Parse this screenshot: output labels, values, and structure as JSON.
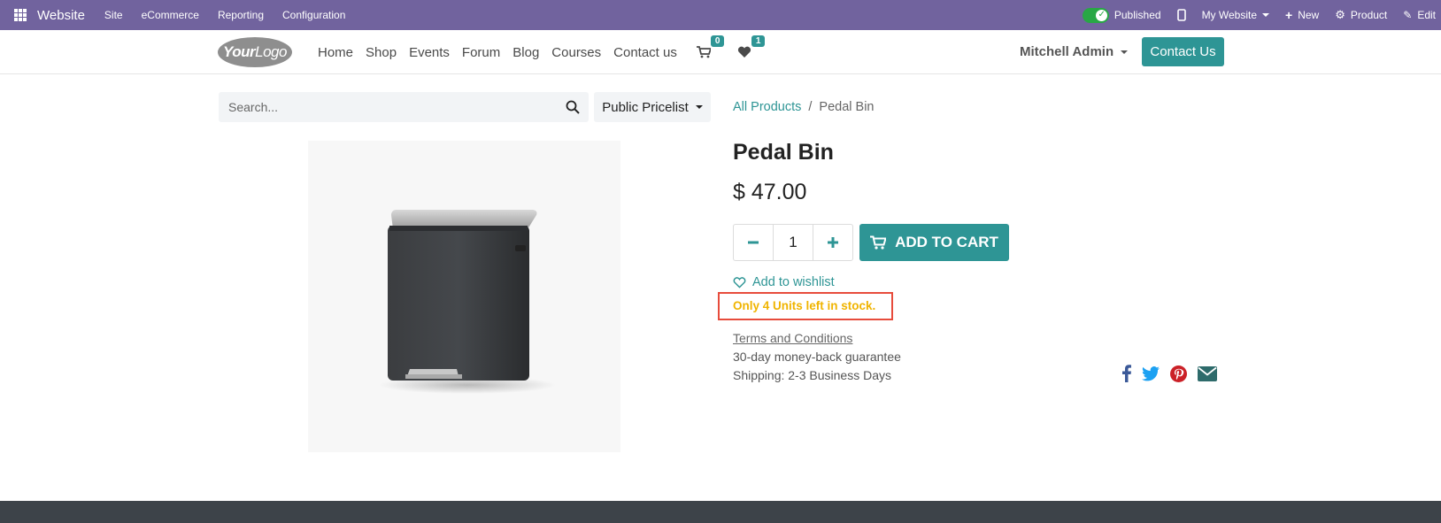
{
  "admin_bar": {
    "brand": "Website",
    "menu": [
      "Site",
      "eCommerce",
      "Reporting",
      "Configuration"
    ],
    "published_label": "Published",
    "website_label": "My Website",
    "new_label": "New",
    "product_label": "Product",
    "edit_label": "Edit"
  },
  "header": {
    "logo_text_bold": "Your",
    "logo_text": "Logo",
    "nav": [
      "Home",
      "Shop",
      "Events",
      "Forum",
      "Blog",
      "Courses",
      "Contact us"
    ],
    "cart_count": "0",
    "wishlist_count": "1",
    "user_name": "Mitchell Admin",
    "contact_button": "Contact Us"
  },
  "search": {
    "placeholder": "Search...",
    "pricelist": "Public Pricelist"
  },
  "breadcrumb": {
    "parent": "All Products",
    "separator": "/",
    "current": "Pedal Bin"
  },
  "product": {
    "name": "Pedal Bin",
    "price": "$ 47.00",
    "quantity": "1",
    "add_to_cart": "ADD TO CART",
    "wishlist": "Add to wishlist",
    "stock_message": "Only 4 Units left in stock.",
    "terms": "Terms and Conditions",
    "guarantee": "30-day money-back guarantee",
    "shipping": "Shipping: 2-3 Business Days"
  },
  "colors": {
    "admin_bar": "#71639e",
    "accent": "#2e9595",
    "stock_warning": "#f0b400",
    "highlight_box": "#e74c3c"
  },
  "icons": {
    "social": [
      "facebook-icon",
      "twitter-icon",
      "pinterest-icon",
      "email-icon"
    ]
  }
}
